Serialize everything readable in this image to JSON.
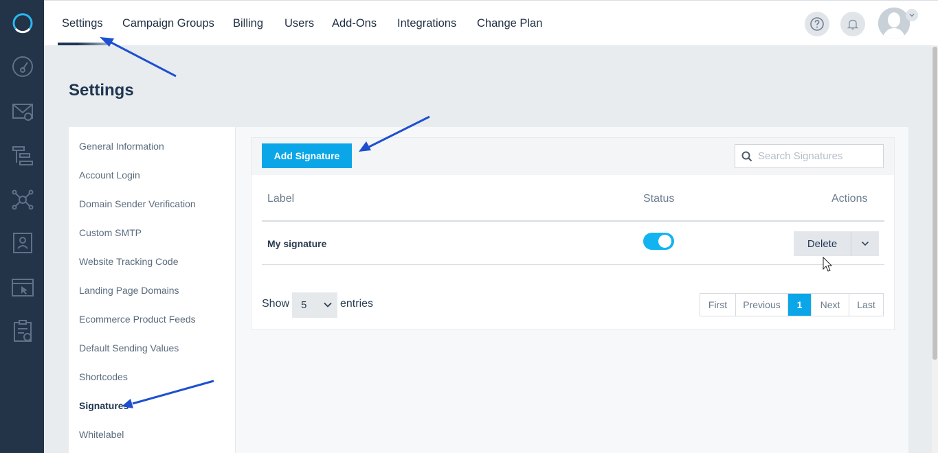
{
  "nav": {
    "tabs": [
      "Settings",
      "Campaign Groups",
      "Billing",
      "Users",
      "Add-Ons",
      "Integrations",
      "Change Plan"
    ],
    "active_tab": "Settings"
  },
  "page": {
    "title": "Settings"
  },
  "sidebar": {
    "items": [
      "General Information",
      "Account Login",
      "Domain Sender Verification",
      "Custom SMTP",
      "Website Tracking Code",
      "Landing Page Domains",
      "Ecommerce Product Feeds",
      "Default Sending Values",
      "Shortcodes",
      "Signatures",
      "Whitelabel"
    ],
    "active": "Signatures"
  },
  "signatures": {
    "add_button": "Add Signature",
    "search_placeholder": "Search Signatures",
    "columns": {
      "label": "Label",
      "status": "Status",
      "actions": "Actions"
    },
    "rows": [
      {
        "label": "My signature",
        "status_on": true,
        "action": "Delete"
      }
    ]
  },
  "footer": {
    "show": "Show",
    "page_size": "5",
    "entries": "entries",
    "pager": {
      "first": "First",
      "previous": "Previous",
      "current": "1",
      "next": "Next",
      "last": "Last"
    }
  },
  "colors": {
    "accent": "#0aa6e8",
    "rail": "#233348",
    "annotation_arrow": "#1d4fd0"
  }
}
